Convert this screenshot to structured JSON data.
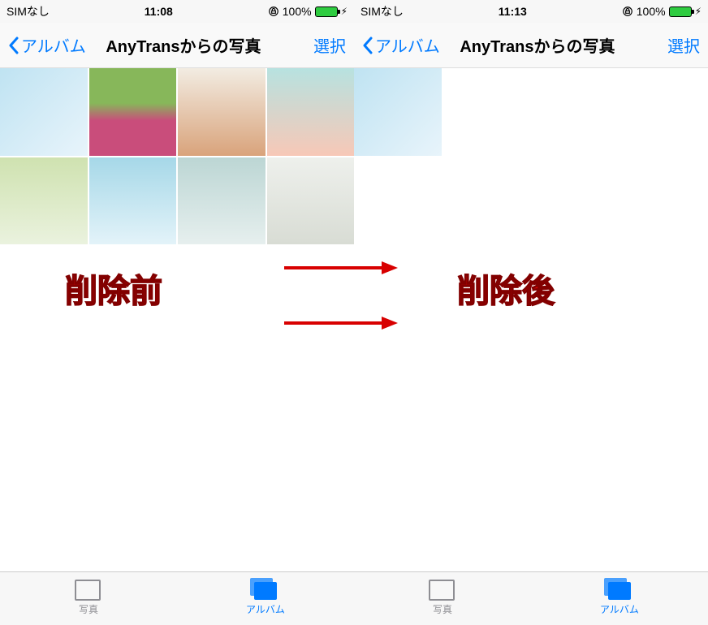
{
  "screens": {
    "before": {
      "status": {
        "carrier": "SIMなし",
        "time": "11:08",
        "battery_pct": "100%"
      },
      "nav": {
        "back_label": "アルバム",
        "title": "AnyTransからの写真",
        "select_label": "選択"
      },
      "photo_count": 8,
      "tabs": {
        "photos_label": "写真",
        "albums_label": "アルバム"
      },
      "caption": "削除前"
    },
    "after": {
      "status": {
        "carrier": "SIMなし",
        "time": "11:13",
        "battery_pct": "100%"
      },
      "nav": {
        "back_label": "アルバム",
        "title": "AnyTransからの写真",
        "select_label": "選択"
      },
      "photo_count": 1,
      "tabs": {
        "photos_label": "写真",
        "albums_label": "アルバム"
      },
      "caption": "削除後"
    }
  }
}
